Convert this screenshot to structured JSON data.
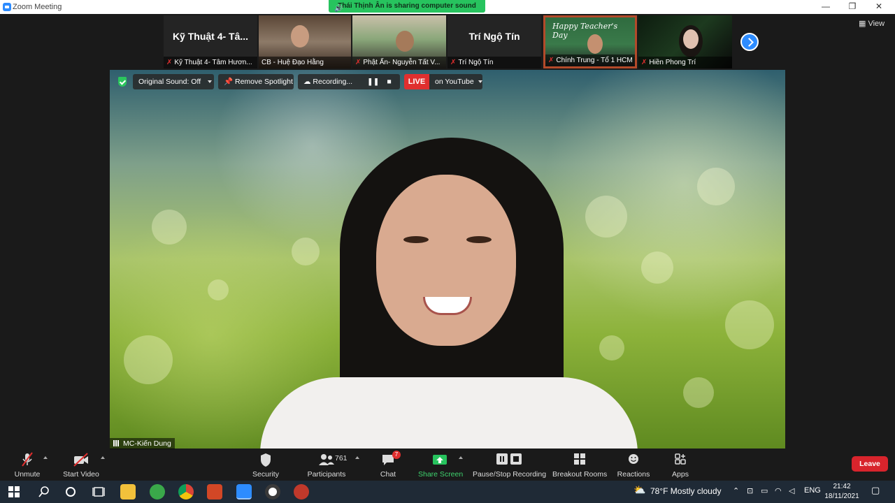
{
  "window": {
    "title": "Zoom Meeting"
  },
  "share_banner": {
    "text": "Thái Thịnh Ân is sharing computer sound"
  },
  "participants_strip": [
    {
      "name": "Kỹ Thuật 4- Tâm Hươn...",
      "display": "Kỹ Thuật 4- Tâ...",
      "video": false
    },
    {
      "name": "CB - Huệ Đạo Hằng",
      "video": true
    },
    {
      "name": "Phật Ấn- Nguyễn Tất V...",
      "video": true
    },
    {
      "name": "Trí Ngộ Tín",
      "display": "Trí Ngộ Tín",
      "video": false
    },
    {
      "name": "Chính Trung - Tổ 1 HCM",
      "video": true,
      "overlay": "Happy Teacher's Day"
    },
    {
      "name": "Hiền Phong Trí",
      "video": true
    }
  ],
  "view_button": {
    "label": "View"
  },
  "meeting_toolbar": {
    "original_sound": "Original Sound: Off",
    "remove_spotlight": "Remove Spotlight",
    "recording": "Recording...",
    "live": "LIVE",
    "live_target": "on YouTube"
  },
  "main_speaker": {
    "name": "MC-Kiến Dung"
  },
  "controls": {
    "unmute": "Unmute",
    "start_video": "Start Video",
    "security": "Security",
    "participants": "Participants",
    "participant_count": "761",
    "chat": "Chat",
    "chat_badge": "7",
    "share_screen": "Share Screen",
    "pause_stop_recording": "Pause/Stop Recording",
    "breakout_rooms": "Breakout Rooms",
    "reactions": "Reactions",
    "apps": "Apps",
    "leave": "Leave"
  },
  "taskbar": {
    "weather": "78°F  Mostly cloudy",
    "language": "ENG",
    "time": "21:42",
    "date": "18/11/2021"
  },
  "colors": {
    "zoom_blue": "#2d8cff",
    "share_green": "#27c35e",
    "live_red": "#e02f2f",
    "leave_red": "#d8242c"
  }
}
